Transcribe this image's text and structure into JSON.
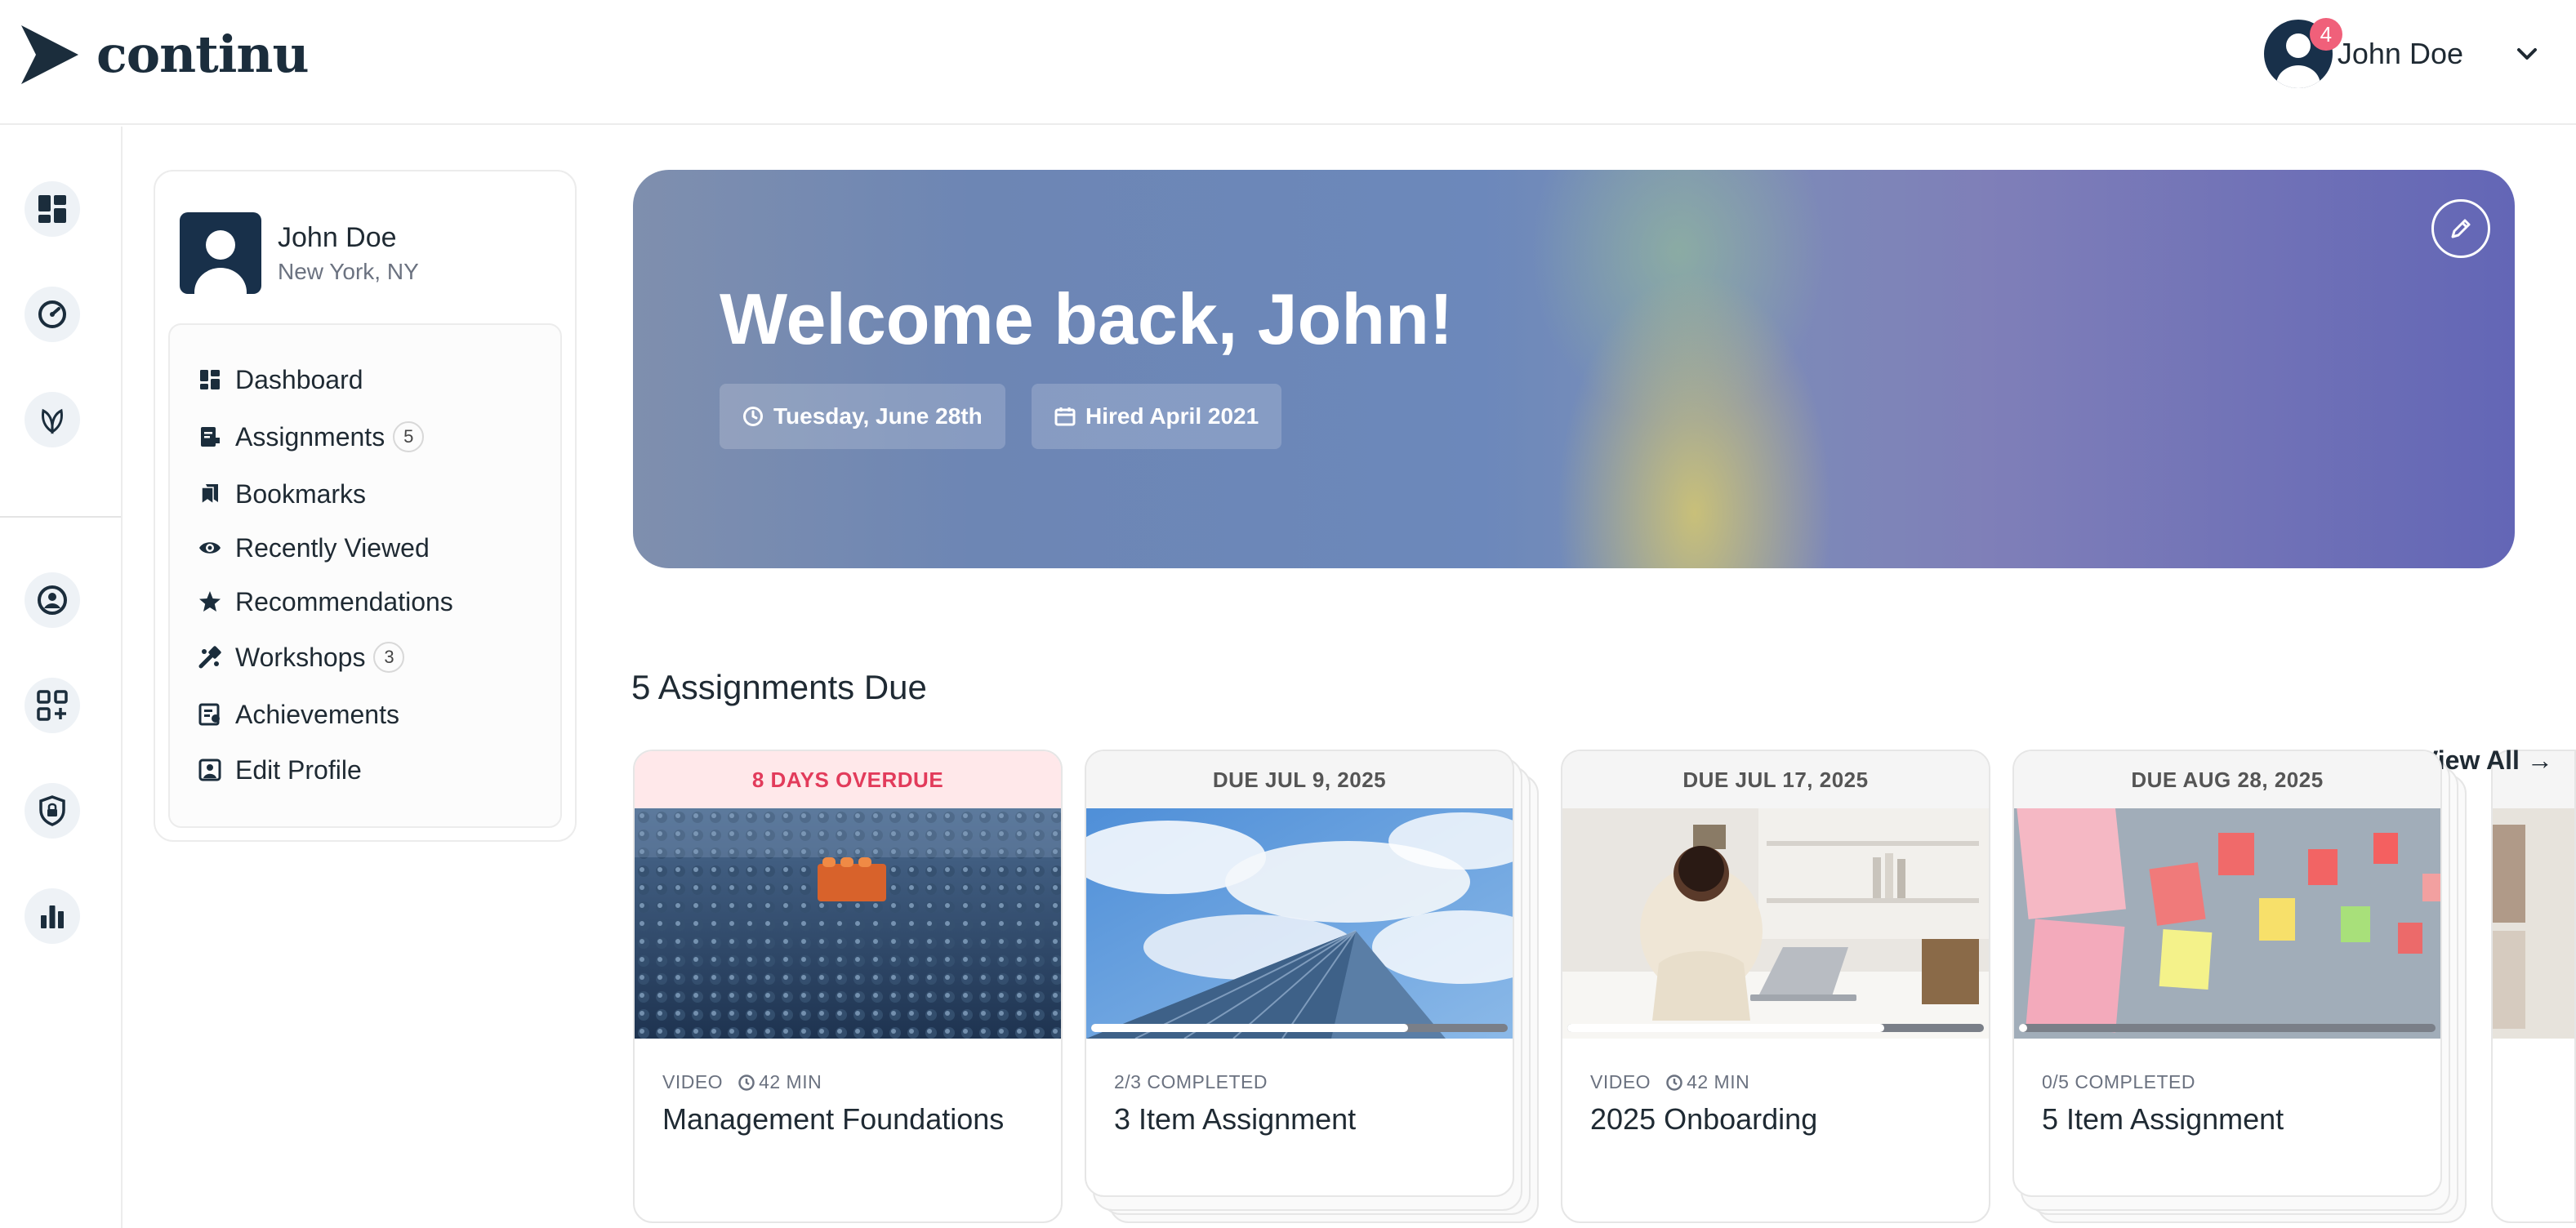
{
  "brand": {
    "name": "continu"
  },
  "header": {
    "user_name": "John Doe",
    "notifications": "4"
  },
  "rail": {
    "items": [
      {
        "icon": "dashboard-icon"
      },
      {
        "icon": "speedometer-icon"
      },
      {
        "icon": "leaf-icon"
      },
      {
        "icon": "user-circle-icon"
      },
      {
        "icon": "apps-add-icon"
      },
      {
        "icon": "shield-lock-icon"
      },
      {
        "icon": "bar-chart-icon"
      }
    ]
  },
  "profile": {
    "name": "John Doe",
    "location": "New York, NY",
    "nav": [
      {
        "label": "Dashboard",
        "icon": "dashboard-icon"
      },
      {
        "label": "Assignments",
        "icon": "assignment-icon",
        "count": "5"
      },
      {
        "label": "Bookmarks",
        "icon": "bookmark-icon"
      },
      {
        "label": "Recently Viewed",
        "icon": "eye-icon"
      },
      {
        "label": "Recommendations",
        "icon": "star-icon"
      },
      {
        "label": "Workshops",
        "icon": "workshop-icon",
        "count": "3"
      },
      {
        "label": "Achievements",
        "icon": "achievement-icon"
      },
      {
        "label": "Edit Profile",
        "icon": "profile-edit-icon"
      }
    ]
  },
  "hero": {
    "title": "Welcome back, John!",
    "date_chip": "Tuesday, June 28th",
    "hired_chip": "Hired April 2021"
  },
  "assignments": {
    "title": "5 Assignments Due",
    "view_all": "View All",
    "cards": [
      {
        "due": "8 DAYS OVERDUE",
        "overdue": true,
        "type": "VIDEO",
        "duration": "42 MIN",
        "title": "Management Foundations",
        "image": "lego-plate"
      },
      {
        "due": "DUE JUL 9, 2025",
        "overdue": false,
        "progress_text": "2/3 COMPLETED",
        "progress": 0.76,
        "title": "3 Item Assignment",
        "image": "skyscraper-sky"
      },
      {
        "due": "DUE JUL 17, 2025",
        "overdue": false,
        "type": "VIDEO",
        "duration": "42 MIN",
        "progress": 0.76,
        "title": "2025 Onboarding",
        "image": "woman-laptop"
      },
      {
        "due": "DUE AUG 28, 2025",
        "overdue": false,
        "progress_text": "0/5 COMPLETED",
        "progress": 0.02,
        "title": "5 Item Assignment",
        "image": "sticky-notes"
      }
    ]
  }
}
